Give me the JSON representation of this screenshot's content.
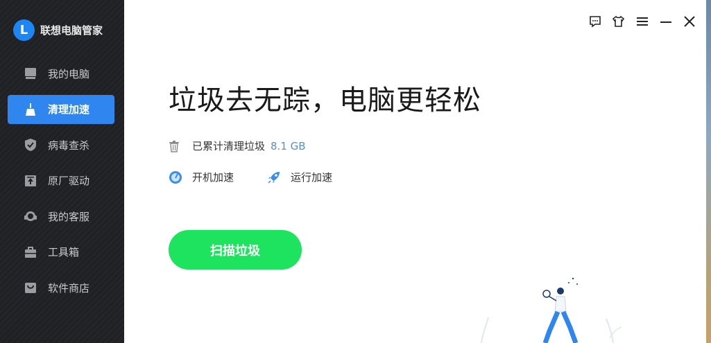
{
  "app": {
    "name": "联想电脑管家",
    "logo_letter": "L"
  },
  "sidebar": {
    "items": [
      {
        "label": "我的电脑",
        "icon": "computer-icon",
        "active": false
      },
      {
        "label": "清理加速",
        "icon": "broom-icon",
        "active": true
      },
      {
        "label": "病毒查杀",
        "icon": "shield-icon",
        "active": false
      },
      {
        "label": "原厂驱动",
        "icon": "driver-icon",
        "active": false
      },
      {
        "label": "我的客服",
        "icon": "headset-icon",
        "active": false
      },
      {
        "label": "工具箱",
        "icon": "toolbox-icon",
        "active": false
      },
      {
        "label": "软件商店",
        "icon": "store-icon",
        "active": false
      }
    ]
  },
  "titlebar": {
    "icons": [
      "feedback-icon",
      "skin-icon",
      "menu-icon",
      "minimize-icon",
      "close-icon"
    ]
  },
  "main": {
    "headline": "垃圾去无踪，电脑更轻松",
    "junk_label": "已累计清理垃圾",
    "junk_amount": "8.1 GB",
    "boot_boost": "开机加速",
    "run_boost": "运行加速",
    "scan_button": "扫描垃圾"
  },
  "colors": {
    "accent": "#2f86ef",
    "scan": "#1ee35e",
    "sidebar_bg": "#1f2124"
  }
}
